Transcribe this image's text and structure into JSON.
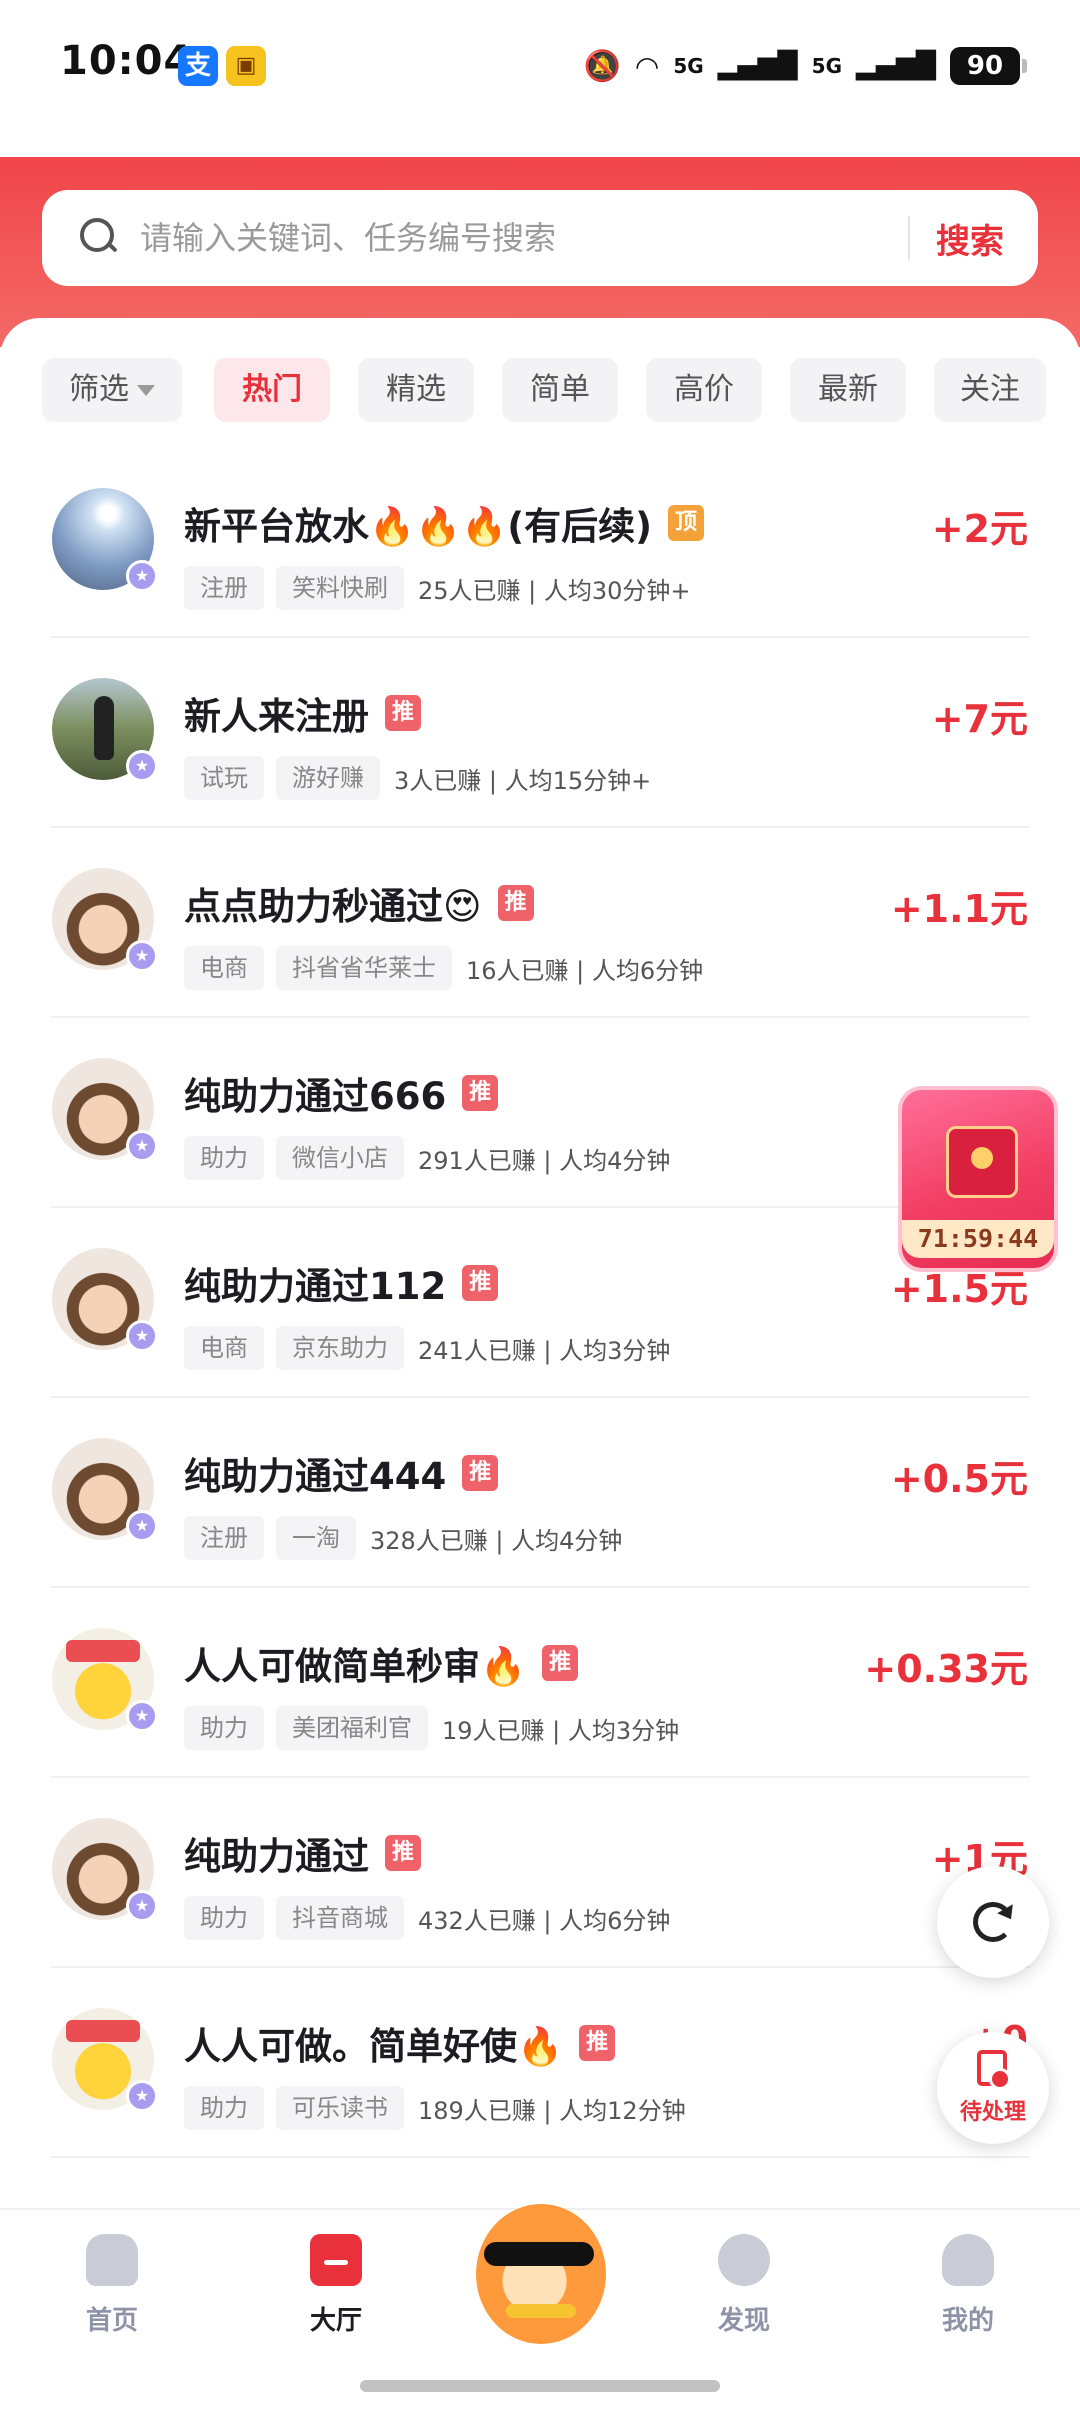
{
  "status_bar": {
    "time": "10:04",
    "app_icons": [
      "支",
      "▣"
    ],
    "network": "5G",
    "battery": "90"
  },
  "search": {
    "placeholder": "请输入关键词、任务编号搜索",
    "button": "搜索"
  },
  "filters": {
    "items": [
      {
        "label": "筛选",
        "active": false
      },
      {
        "label": "热门",
        "active": true
      },
      {
        "label": "精选",
        "active": false
      },
      {
        "label": "简单",
        "active": false
      },
      {
        "label": "高价",
        "active": false
      },
      {
        "label": "最新",
        "active": false
      },
      {
        "label": "关注",
        "active": false
      }
    ]
  },
  "tasks": [
    {
      "title": "新平台放水🔥🔥🔥(有后续)",
      "badge": "顶",
      "tags": [
        "注册",
        "笑料快刷"
      ],
      "stats": "25人已赚 | 人均30分钟+",
      "reward": "+2元",
      "avatar": "sky"
    },
    {
      "title": "新人来注册",
      "badge": "推",
      "tags": [
        "试玩",
        "游好赚"
      ],
      "stats": "3人已赚 | 人均15分钟+",
      "reward": "+7元",
      "avatar": "girl"
    },
    {
      "title": "点点助力秒通过😍",
      "badge": "推",
      "tags": [
        "电商",
        "抖省省华莱士"
      ],
      "stats": "16人已赚 | 人均6分钟",
      "reward": "+1.1元",
      "avatar": "boy"
    },
    {
      "title": "纯助力通过666",
      "badge": "推",
      "tags": [
        "助力",
        "微信小店"
      ],
      "stats": "291人已赚 | 人均4分钟",
      "reward": "",
      "avatar": "boy"
    },
    {
      "title": "纯助力通过112",
      "badge": "推",
      "tags": [
        "电商",
        "京东助力"
      ],
      "stats": "241人已赚 | 人均3分钟",
      "reward": "+1.5元",
      "avatar": "boy"
    },
    {
      "title": "纯助力通过444",
      "badge": "推",
      "tags": [
        "注册",
        "一淘"
      ],
      "stats": "328人已赚 | 人均4分钟",
      "reward": "+0.5元",
      "avatar": "boy"
    },
    {
      "title": "人人可做简单秒审🔥",
      "badge": "推",
      "tags": [
        "助力",
        "美团福利官"
      ],
      "stats": "19人已赚 | 人均3分钟",
      "reward": "+0.33元",
      "avatar": "cat"
    },
    {
      "title": "纯助力通过",
      "badge": "推",
      "tags": [
        "助力",
        "抖音商城"
      ],
      "stats": "432人已赚 | 人均6分钟",
      "reward": "+1元",
      "avatar": "boy"
    },
    {
      "title": "人人可做。简单好使🔥",
      "badge": "推",
      "tags": [
        "助力",
        "可乐读书"
      ],
      "stats": "189人已赚 | 人均12分钟",
      "reward": "+0",
      "avatar": "cat"
    }
  ],
  "float_packet": {
    "timer": "71:59:44"
  },
  "fab": {
    "pending_label": "待处理"
  },
  "nav": {
    "items": [
      {
        "label": "首页",
        "icon": "home-icon",
        "active": false
      },
      {
        "label": "大厅",
        "icon": "hall-icon",
        "active": true
      },
      {
        "label": "发现",
        "icon": "discover-icon",
        "active": false
      },
      {
        "label": "我的",
        "icon": "profile-icon",
        "active": false
      }
    ]
  },
  "colors": {
    "accent": "#e8313a",
    "header": "#f0454a",
    "muted": "#8e93a8"
  }
}
